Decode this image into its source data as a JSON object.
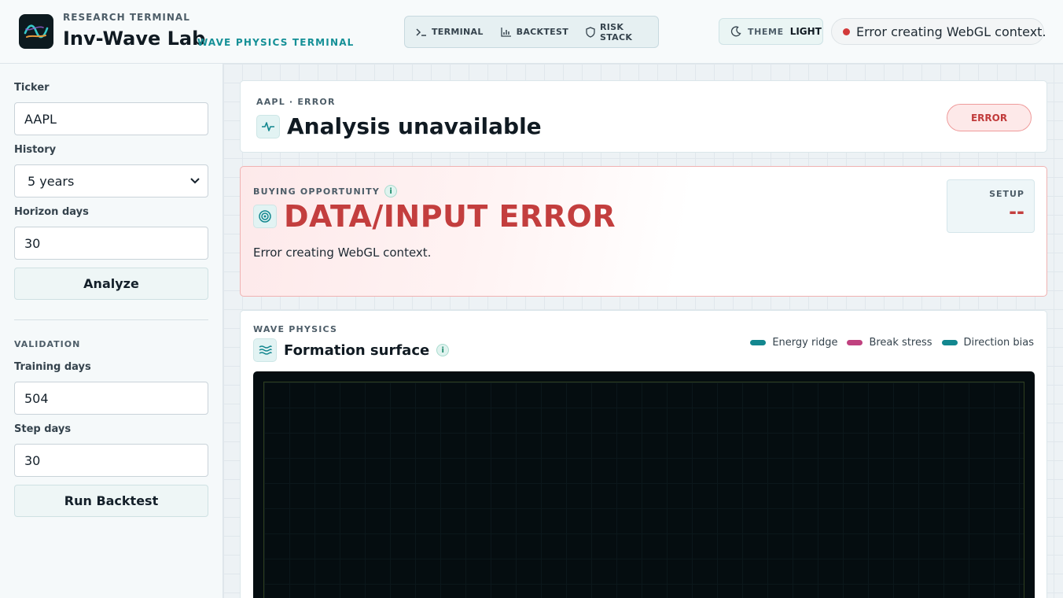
{
  "header": {
    "kicker": "RESEARCH TERMINAL",
    "title": "Inv-Wave Lab",
    "subtitle": "WAVE PHYSICS TERMINAL",
    "nav": [
      {
        "label": "TERMINAL",
        "icon": "terminal-prompt-icon"
      },
      {
        "label": "BACKTEST",
        "icon": "bar-chart-icon"
      },
      {
        "label": "RISK STACK",
        "icon": "shield-icon"
      }
    ],
    "theme_label": "THEME",
    "theme_value": "LIGHT",
    "status_text": "Error creating WebGL context.",
    "status_color": "#d23a3a"
  },
  "sidebar": {
    "ticker_label": "Ticker",
    "ticker_value": "AAPL",
    "history_label": "History",
    "history_value": "5 years",
    "horizon_label": "Horizon days",
    "horizon_value": "30",
    "analyze_label": "Analyze",
    "validation_label": "VALIDATION",
    "training_label": "Training days",
    "training_value": "504",
    "step_label": "Step days",
    "step_value": "30",
    "backtest_label": "Run Backtest"
  },
  "summary_card": {
    "kicker": "AAPL · ERROR",
    "title": "Analysis unavailable",
    "badge": "ERROR"
  },
  "signal_card": {
    "kicker": "BUYING OPPORTUNITY",
    "info": "i",
    "headline": "DATA/INPUT ERROR",
    "message": "Error creating WebGL context.",
    "setup_label": "SETUP",
    "setup_value": "--",
    "accent_color": "#c33e3e"
  },
  "surface_card": {
    "kicker": "WAVE PHYSICS",
    "title": "Formation surface",
    "info": "i",
    "legend": [
      {
        "label": "Energy ridge",
        "color": "#13878f"
      },
      {
        "label": "Break stress",
        "color": "#c0417f"
      },
      {
        "label": "Direction bias",
        "color": "#13878f"
      }
    ]
  }
}
